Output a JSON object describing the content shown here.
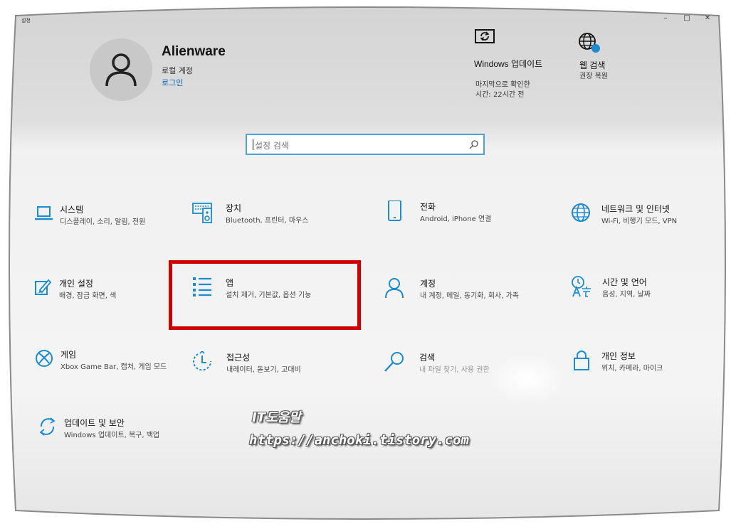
{
  "window": {
    "title": "설정",
    "minimize": "–",
    "maximize": "□",
    "close": "✕"
  },
  "account": {
    "name": "Alienware",
    "type": "로컬 계정",
    "login": "로그인"
  },
  "header_items": [
    {
      "title": "Windows 업데이트",
      "sub1": "마지막으로 확인한",
      "sub2": "시간: 22시간 전",
      "icon": "sync-icon"
    },
    {
      "title": "웹 검색",
      "sub1": "권장 복원",
      "icon": "globe-icon"
    }
  ],
  "search": {
    "placeholder": "설정 검색"
  },
  "categories": [
    {
      "name": "시스템",
      "desc": "디스플레이, 소리, 알림, 전원",
      "icon": "laptop-icon"
    },
    {
      "name": "장치",
      "desc": "Bluetooth, 프린터, 마우스",
      "icon": "keyboard-speaker-icon"
    },
    {
      "name": "전화",
      "desc": "Android, iPhone 연결",
      "icon": "phone-icon"
    },
    {
      "name": "네트워크 및 인터넷",
      "desc": "Wi-Fi, 비행기 모드, VPN",
      "icon": "globe-icon"
    },
    {
      "name": "개인 설정",
      "desc": "배경, 잠금 화면, 색",
      "icon": "paint-icon"
    },
    {
      "name": "앱",
      "desc": "설치 제거, 기본값, 옵션 기능",
      "icon": "app-list-icon"
    },
    {
      "name": "계정",
      "desc": "내 계정, 메일, 동기화, 회사, 가족",
      "icon": "person-icon"
    },
    {
      "name": "시간 및 언어",
      "desc": "음성, 지역, 날짜",
      "icon": "time-language-icon"
    },
    {
      "name": "게임",
      "desc": "Xbox Game Bar, 캡처, 게임 모드",
      "icon": "xbox-icon"
    },
    {
      "name": "접근성",
      "desc": "내레이터, 돋보기, 고대비",
      "icon": "ease-of-access-icon"
    },
    {
      "name": "검색",
      "desc": "내 파일 찾기, 사용 권한",
      "icon": "search-icon"
    },
    {
      "name": "개인 정보",
      "desc": "위치, 카메라, 마이크",
      "icon": "lock-icon"
    },
    {
      "name": "업데이트 및 보안",
      "desc": "Windows 업데이트, 복구, 백업",
      "icon": "update-icon"
    }
  ],
  "watermark": {
    "line1": "IT도움말",
    "line2": "https://anchoki.tistory.com"
  },
  "colors": {
    "accent": "#0067b8",
    "icon": "#1a8ccf",
    "highlight": "#d00000",
    "search_border": "#4aa4d4"
  }
}
